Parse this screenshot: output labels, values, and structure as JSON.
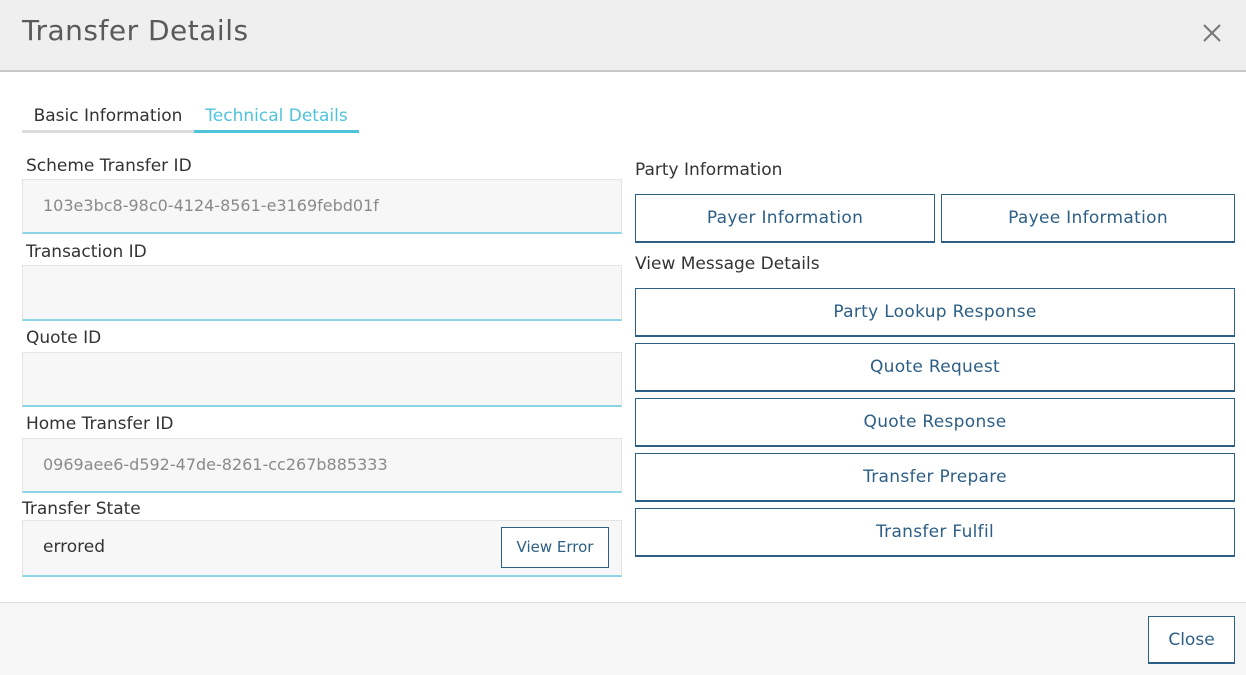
{
  "modal": {
    "title": "Transfer Details",
    "close_icon": "close-icon"
  },
  "tabs": [
    {
      "label": "Basic Information",
      "active": false
    },
    {
      "label": "Technical Details",
      "active": true
    }
  ],
  "fields": {
    "scheme_transfer_id": {
      "label": "Scheme Transfer ID",
      "value": "103e3bc8-98c0-4124-8561-e3169febd01f"
    },
    "transaction_id": {
      "label": "Transaction ID",
      "value": ""
    },
    "quote_id": {
      "label": "Quote ID",
      "value": ""
    },
    "home_transfer_id": {
      "label": "Home Transfer ID",
      "value": "0969aee6-d592-47de-8261-cc267b885333"
    },
    "transfer_state": {
      "label": "Transfer State",
      "value": "errored",
      "action_label": "View Error"
    }
  },
  "party_information": {
    "label": "Party Information",
    "payer_label": "Payer Information",
    "payee_label": "Payee Information"
  },
  "message_details": {
    "label": "View Message Details",
    "buttons": [
      "Party Lookup Response",
      "Quote Request",
      "Quote Response",
      "Transfer Prepare",
      "Transfer Fulfil"
    ]
  },
  "footer": {
    "close_label": "Close"
  },
  "colors": {
    "accent": "#4fc3dc",
    "button": "#2d5f86"
  }
}
